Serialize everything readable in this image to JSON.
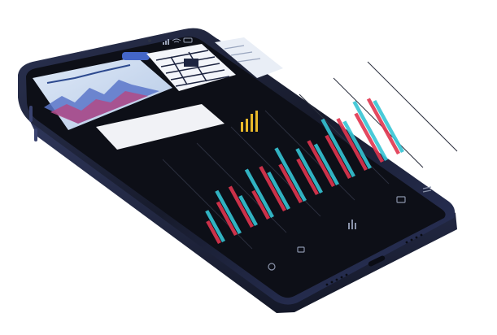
{
  "scene": "smartphone-mockup",
  "status_bar": {
    "right_icons": [
      "signal-icon",
      "wifi-icon",
      "battery-icon"
    ]
  },
  "top_cards": [
    {
      "name": "area-chart-thumbnail",
      "badge": ""
    },
    {
      "name": "table-thumbnail"
    },
    {
      "name": "settings-thumbnail"
    }
  ],
  "info_panel": {
    "line_1": "",
    "line_2": ""
  },
  "stat_labels": [
    "",
    "",
    ""
  ],
  "bottom_nav": {
    "icons": [
      "camera-icon",
      "photos-icon",
      "audio-icon",
      "gallery-icon",
      "menu-icon"
    ]
  },
  "colors": {
    "frame": "#1b2033",
    "screen": "#0d0f17",
    "accent_red": "#e0354f",
    "accent_cyan": "#35c4d4",
    "accent_gold": "#e8b82a",
    "grid": "#2b2f3e"
  },
  "chart_data": {
    "type": "bar",
    "series": [
      {
        "values": [
          30,
          45,
          55,
          38,
          60,
          52,
          48,
          62,
          58,
          70,
          66,
          75
        ]
      },
      {
        "values": [
          42,
          58,
          40,
          65,
          50,
          72,
          60,
          55,
          78,
          64,
          80,
          70
        ]
      }
    ]
  }
}
